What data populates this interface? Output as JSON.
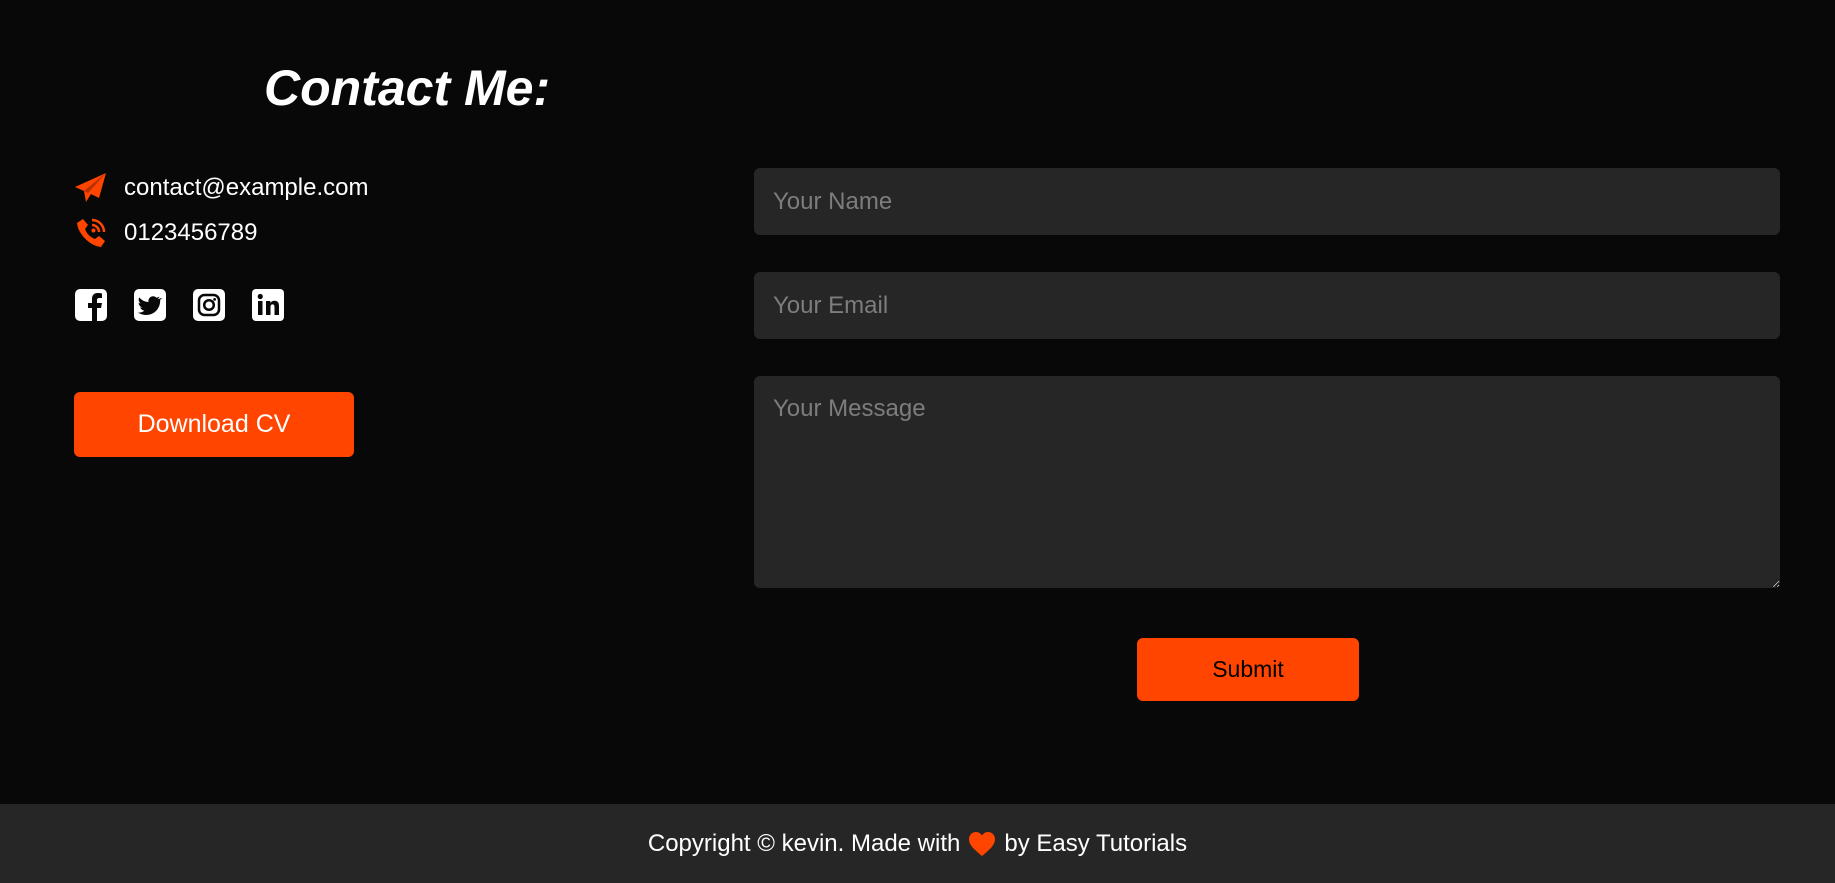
{
  "colors": {
    "background": "#080808",
    "accent": "#ff4500",
    "field_background": "#262626",
    "footer_background": "#262626",
    "placeholder": "#7d7d7d"
  },
  "contact": {
    "title": "Contact Me:",
    "email": {
      "icon": "paper-plane-icon",
      "text": "contact@example.com"
    },
    "phone": {
      "icon": "phone-volume-icon",
      "text": "0123456789"
    }
  },
  "social": [
    {
      "icon": "facebook-icon"
    },
    {
      "icon": "twitter-icon"
    },
    {
      "icon": "instagram-icon"
    },
    {
      "icon": "linkedin-icon"
    }
  ],
  "download_button": {
    "label": "Download CV"
  },
  "form": {
    "name": {
      "placeholder": "Your Name",
      "value": ""
    },
    "email": {
      "placeholder": "Your Email",
      "value": ""
    },
    "message": {
      "placeholder": "Your Message",
      "value": ""
    },
    "submit_label": "Submit"
  },
  "footer": {
    "text_before": "Copyright © kevin. Made with",
    "heart_icon": "heart-icon",
    "text_after": "by Easy Tutorials"
  }
}
